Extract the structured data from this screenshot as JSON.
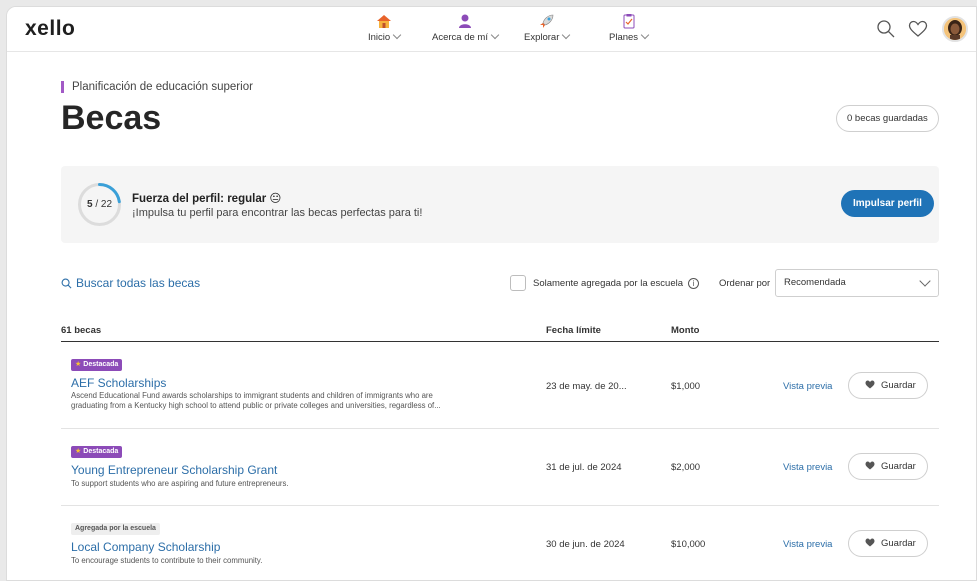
{
  "header": {
    "logo": "xello",
    "nav": [
      {
        "label": "Inicio",
        "icon": "house-icon"
      },
      {
        "label": "Acerca de mí",
        "icon": "person-icon"
      },
      {
        "label": "Explorar",
        "icon": "rocket-icon"
      },
      {
        "label": "Planes",
        "icon": "clipboard-icon"
      }
    ],
    "icons": [
      "search-icon",
      "heart-icon",
      "avatar"
    ]
  },
  "page": {
    "eyebrow": "Planificación de educación superior",
    "title": "Becas",
    "saved_label": "0 becas guardadas"
  },
  "profile": {
    "score": "5",
    "total": "22",
    "progress": 0.227,
    "title": "Fuerza del perfil: regular",
    "emoji": "😐",
    "subtitle": "¡Impulsa tu perfil para encontrar las becas perfectas para ti!",
    "button": "Impulsar perfil"
  },
  "filters": {
    "search_label": "Buscar todas las becas",
    "school_only_label": "Solamente agregada por la escuela",
    "sort_label": "Ordenar por",
    "sort_value": "Recomendada"
  },
  "table": {
    "count_header": "61 becas",
    "deadline_header": "Fecha límite",
    "amount_header": "Monto",
    "preview_label": "Vista previa",
    "save_label": "Guardar",
    "rows": [
      {
        "badge": "Destacada",
        "badge_type": "featured",
        "name": "AEF Scholarships",
        "desc1": "Ascend Educational Fund awards scholarships to immigrant students and children of immigrants who are",
        "desc2": "graduating from a Kentucky high school to attend public or private colleges and universities, regardless of...",
        "deadline": "23 de may. de 20...",
        "amount": "$1,000"
      },
      {
        "badge": "Destacada",
        "badge_type": "featured",
        "name": "Young Entrepreneur Scholarship Grant",
        "desc1": "To support students who are aspiring and future entrepreneurs.",
        "desc2": "",
        "deadline": "31 de jul. de 2024",
        "amount": "$2,000"
      },
      {
        "badge": "Agregada por la escuela",
        "badge_type": "school",
        "name": "Local Company Scholarship",
        "desc1": "To encourage students to contribute to their community.",
        "desc2": "",
        "deadline": "30 de jun. de 2024",
        "amount": "$10,000"
      }
    ]
  },
  "colors": {
    "brand_blue": "#1f73b7",
    "link_blue": "#2c6ea8",
    "featured_purple": "#8c4bb8",
    "accent_purple": "#a25ac6"
  }
}
